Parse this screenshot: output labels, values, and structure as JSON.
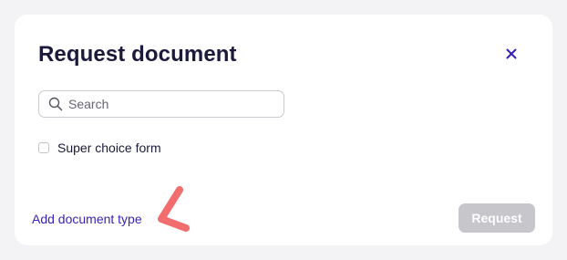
{
  "modal": {
    "title": "Request document",
    "close_icon": "close-icon"
  },
  "search": {
    "placeholder": "Search",
    "value": "",
    "icon": "search-icon"
  },
  "options": [
    {
      "label": "Super choice form",
      "checked": false
    }
  ],
  "footer": {
    "add_link": "Add document type",
    "request_label": "Request",
    "request_enabled": false
  },
  "colors": {
    "accent": "#3a1fb8",
    "title": "#1c1a3a",
    "annotation": "#f26d6d",
    "disabled_button": "#c6c6cb"
  }
}
